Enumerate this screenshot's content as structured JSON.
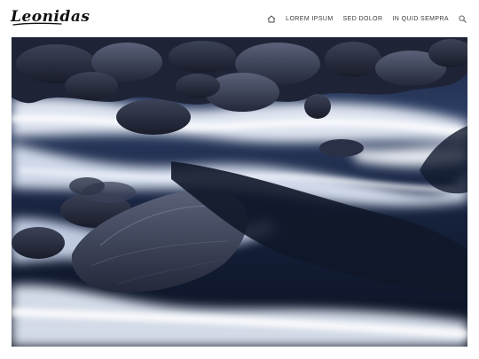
{
  "header": {
    "logo_text": "Leonidas",
    "nav": [
      {
        "label": ""
      },
      {
        "label": "LOREM IPSUM"
      },
      {
        "label": "SED DOLOR"
      },
      {
        "label": "IN QUID SEMPRA"
      }
    ]
  },
  "icons": {
    "home": "home-icon",
    "search": "search-icon"
  },
  "colors": {
    "text": "#3a3a3a",
    "logo": "#111111",
    "background": "#ffffff"
  }
}
